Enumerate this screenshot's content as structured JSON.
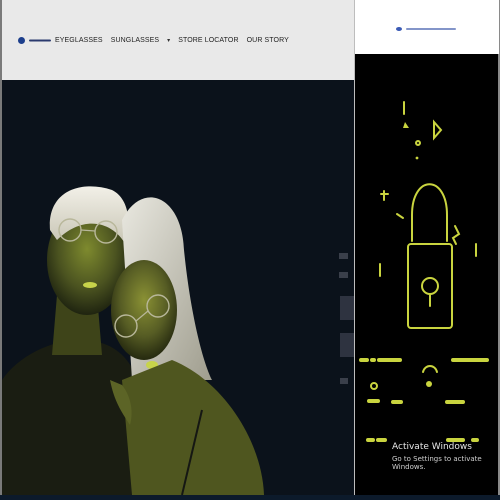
{
  "header": {
    "logo_text": "",
    "nav": {
      "eyeglasses": "EYEGLASSES",
      "sunglasses": "SUNGLASSES",
      "store_locator": "STORE LOCATOR",
      "our_story": "OUR STORY"
    }
  },
  "hero": {
    "image_alt": ""
  },
  "overlay": {
    "logo_text": "",
    "illustration": "lock-illustration"
  },
  "watermark": {
    "title": "Activate Windows",
    "subtitle": "Go to Settings to activate Windows."
  },
  "colors": {
    "header_bg": "#e9e9e9",
    "hero_bg": "#0b121b",
    "accent": "#c9d43f",
    "overlay_bg": "#000000"
  }
}
